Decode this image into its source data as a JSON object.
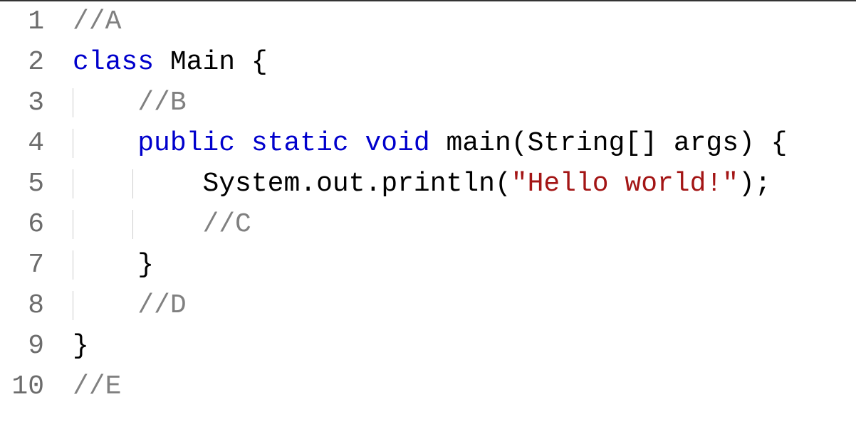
{
  "editor": {
    "indent_size": 4,
    "lines": [
      {
        "num": "1",
        "indent": 0,
        "guides": [],
        "tokens": [
          {
            "text": "//A",
            "cls": "tok-comment"
          }
        ]
      },
      {
        "num": "2",
        "indent": 0,
        "guides": [],
        "tokens": [
          {
            "text": "class",
            "cls": "tok-keyword"
          },
          {
            "text": " ",
            "cls": "tok-plain"
          },
          {
            "text": "Main",
            "cls": "tok-plain"
          },
          {
            "text": " {",
            "cls": "tok-punct"
          }
        ]
      },
      {
        "num": "3",
        "indent": 1,
        "guides": [
          1
        ],
        "tokens": [
          {
            "text": "//B",
            "cls": "tok-comment"
          }
        ]
      },
      {
        "num": "4",
        "indent": 1,
        "guides": [
          1
        ],
        "tokens": [
          {
            "text": "public",
            "cls": "tok-keyword"
          },
          {
            "text": " ",
            "cls": "tok-plain"
          },
          {
            "text": "static",
            "cls": "tok-keyword"
          },
          {
            "text": " ",
            "cls": "tok-plain"
          },
          {
            "text": "void",
            "cls": "tok-keyword"
          },
          {
            "text": " ",
            "cls": "tok-plain"
          },
          {
            "text": "main",
            "cls": "tok-plain"
          },
          {
            "text": "(",
            "cls": "tok-punct"
          },
          {
            "text": "String",
            "cls": "tok-plain"
          },
          {
            "text": "[] ",
            "cls": "tok-punct"
          },
          {
            "text": "args",
            "cls": "tok-plain"
          },
          {
            "text": ") {",
            "cls": "tok-punct"
          }
        ]
      },
      {
        "num": "5",
        "indent": 2,
        "guides": [
          1,
          2
        ],
        "tokens": [
          {
            "text": "System",
            "cls": "tok-plain"
          },
          {
            "text": ".",
            "cls": "tok-punct"
          },
          {
            "text": "out",
            "cls": "tok-plain"
          },
          {
            "text": ".",
            "cls": "tok-punct"
          },
          {
            "text": "println",
            "cls": "tok-plain"
          },
          {
            "text": "(",
            "cls": "tok-punct"
          },
          {
            "text": "\"Hello world!\"",
            "cls": "tok-string"
          },
          {
            "text": ");",
            "cls": "tok-punct"
          }
        ]
      },
      {
        "num": "6",
        "indent": 2,
        "guides": [
          1,
          2
        ],
        "tokens": [
          {
            "text": "//C",
            "cls": "tok-comment"
          }
        ]
      },
      {
        "num": "7",
        "indent": 1,
        "guides": [
          1
        ],
        "tokens": [
          {
            "text": "}",
            "cls": "tok-punct"
          }
        ]
      },
      {
        "num": "8",
        "indent": 1,
        "guides": [
          1
        ],
        "tokens": [
          {
            "text": "//D",
            "cls": "tok-comment"
          }
        ]
      },
      {
        "num": "9",
        "indent": 0,
        "guides": [],
        "tokens": [
          {
            "text": "}",
            "cls": "tok-punct"
          }
        ]
      },
      {
        "num": "10",
        "indent": 0,
        "guides": [],
        "tokens": [
          {
            "text": "//E",
            "cls": "tok-comment"
          }
        ]
      }
    ]
  }
}
